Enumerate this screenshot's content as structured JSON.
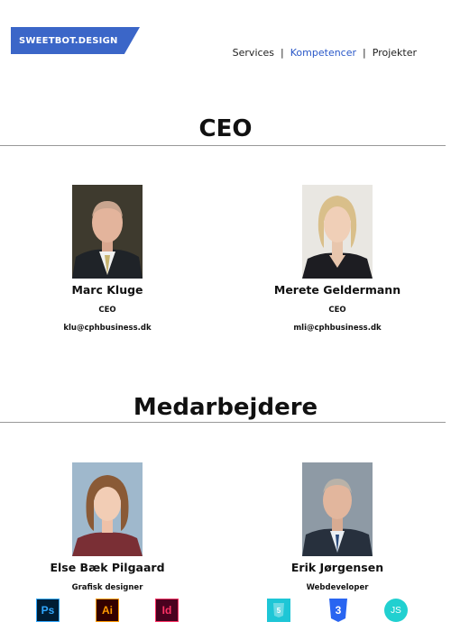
{
  "header": {
    "logo": "SWEETBOT.DESIGN",
    "nav": [
      {
        "label": "Services",
        "active": false
      },
      {
        "label": "Kompetencer",
        "active": true
      },
      {
        "label": "Projekter",
        "active": false
      }
    ],
    "separator": "|"
  },
  "sections": {
    "ceo_title": "CEO",
    "staff_title": "Medarbejdere"
  },
  "ceo": [
    {
      "name": "Marc Kluge",
      "role": "CEO",
      "email": "klu@cphbusiness.dk"
    },
    {
      "name": "Merete Geldermann",
      "role": "CEO",
      "email": "mli@cphbusiness.dk"
    }
  ],
  "staff": [
    {
      "name": "Else Bæk Pilgaard",
      "role": "Grafisk designer"
    },
    {
      "name": "Erik Jørgensen",
      "role": "Webdeveloper"
    }
  ],
  "skills": {
    "designer_icons": [
      "Ps",
      "Ai",
      "Id"
    ],
    "developer_icons": [
      "html5-icon",
      "css3-icon",
      "JS"
    ],
    "colors": {
      "photoshop": "#31a8ff",
      "illustrator": "#ff9a00",
      "indesign": "#ff3366",
      "html": "#1ec6d6",
      "css": "#2965f1",
      "js": "#21d0d0"
    }
  },
  "colors": {
    "brand": "#3b66c8",
    "nav_active": "#2a58c8"
  }
}
